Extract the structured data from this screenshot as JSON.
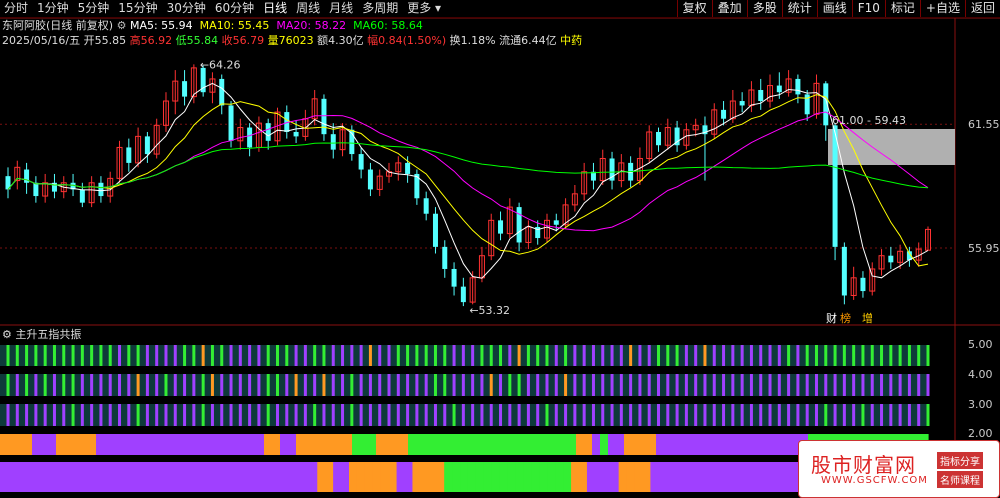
{
  "toolbar": {
    "periods": [
      "分时",
      "1分钟",
      "5分钟",
      "15分钟",
      "30分钟",
      "60分钟",
      "日线",
      "周线",
      "月线",
      "多周期",
      "更多"
    ],
    "active_period": "日线",
    "tools": [
      "复权",
      "叠加",
      "多股",
      "统计",
      "画线",
      "F10",
      "标记",
      "+自选",
      "返回"
    ]
  },
  "info": {
    "stock": "东阿阿胶(日线 前复权)",
    "ma5": "MA5: 55.94",
    "ma10": "MA10: 55.45",
    "ma20": "MA20: 58.22",
    "ma60": "MA60: 58.64",
    "date": "2025/05/16/五",
    "open": "开55.85",
    "high": "高56.92",
    "low": "低55.84",
    "close": "收56.79",
    "volume": "量76023",
    "amount": "额4.30亿",
    "change": "幅0.84(1.50%)",
    "turnover": "换1.18%",
    "float": "流通6.44亿",
    "sector": "中药"
  },
  "colors": {
    "up": "#ff3232",
    "down": "#54ffff",
    "ma5": "#ffffff",
    "ma10": "#ffff00",
    "ma20": "#ff00ff",
    "ma60": "#00ff00"
  },
  "chart_data": {
    "type": "candlestick",
    "price_axis_labels": [
      "61.55",
      "55.95"
    ],
    "annotations": {
      "high": "64.26",
      "low": "53.32",
      "range": "61.00 - 59.43",
      "events": [
        "财",
        "榜",
        "增"
      ]
    },
    "candles": [
      [
        59.2,
        58.6,
        58.2,
        59.6
      ],
      [
        59.0,
        59.6,
        58.6,
        59.9
      ],
      [
        59.5,
        58.9,
        58.4,
        59.8
      ],
      [
        58.9,
        58.3,
        58.0,
        59.2
      ],
      [
        58.3,
        58.9,
        58.0,
        59.3
      ],
      [
        58.9,
        58.5,
        58.2,
        59.3
      ],
      [
        58.5,
        58.9,
        58.2,
        59.2
      ],
      [
        58.9,
        58.6,
        58.3,
        59.3
      ],
      [
        58.6,
        58.0,
        57.8,
        58.9
      ],
      [
        58.0,
        58.9,
        57.8,
        59.2
      ],
      [
        58.9,
        58.3,
        58.0,
        59.2
      ],
      [
        58.3,
        59.1,
        58.0,
        59.4
      ],
      [
        59.1,
        60.5,
        58.9,
        60.8
      ],
      [
        60.5,
        59.8,
        59.4,
        60.9
      ],
      [
        59.8,
        61.0,
        59.6,
        61.4
      ],
      [
        61.0,
        60.2,
        59.8,
        61.2
      ],
      [
        60.2,
        61.5,
        60.0,
        61.8
      ],
      [
        61.5,
        62.6,
        61.2,
        63.0
      ],
      [
        62.6,
        63.5,
        62.0,
        64.0
      ],
      [
        63.5,
        62.8,
        62.4,
        64.0
      ],
      [
        62.8,
        64.1,
        62.5,
        64.26
      ],
      [
        64.1,
        63.0,
        62.8,
        64.2
      ],
      [
        63.0,
        63.6,
        62.5,
        63.9
      ],
      [
        63.6,
        62.4,
        62.0,
        63.8
      ],
      [
        62.4,
        60.8,
        60.5,
        62.6
      ],
      [
        60.8,
        61.4,
        60.4,
        61.8
      ],
      [
        61.4,
        60.5,
        60.1,
        61.6
      ],
      [
        60.5,
        61.6,
        60.3,
        61.9
      ],
      [
        61.6,
        60.8,
        60.4,
        61.8
      ],
      [
        60.8,
        62.1,
        60.6,
        62.3
      ],
      [
        62.1,
        61.2,
        60.9,
        62.4
      ],
      [
        61.2,
        61.0,
        60.7,
        61.7
      ],
      [
        61.0,
        61.8,
        60.8,
        62.2
      ],
      [
        61.8,
        62.7,
        61.5,
        63.1
      ],
      [
        62.7,
        61.1,
        60.8,
        62.9
      ],
      [
        61.1,
        60.4,
        60.0,
        61.6
      ],
      [
        60.4,
        61.3,
        60.1,
        61.6
      ],
      [
        61.3,
        60.2,
        59.9,
        61.5
      ],
      [
        60.2,
        59.5,
        59.1,
        60.5
      ],
      [
        59.5,
        58.6,
        58.3,
        59.8
      ],
      [
        58.6,
        59.2,
        58.3,
        59.5
      ],
      [
        59.2,
        59.4,
        58.9,
        59.8
      ],
      [
        59.4,
        59.8,
        59.0,
        60.1
      ],
      [
        59.8,
        59.3,
        58.9,
        60.1
      ],
      [
        59.3,
        58.2,
        57.9,
        59.5
      ],
      [
        58.2,
        57.5,
        57.2,
        58.5
      ],
      [
        57.5,
        56.0,
        55.7,
        57.8
      ],
      [
        56.0,
        55.0,
        54.6,
        56.3
      ],
      [
        55.0,
        54.2,
        53.8,
        55.3
      ],
      [
        54.2,
        53.5,
        53.32,
        54.6
      ],
      [
        53.5,
        54.6,
        53.4,
        54.9
      ],
      [
        54.6,
        55.6,
        54.4,
        56.0
      ],
      [
        55.6,
        57.2,
        55.4,
        57.5
      ],
      [
        57.2,
        56.6,
        56.3,
        57.6
      ],
      [
        56.6,
        57.8,
        56.4,
        58.2
      ],
      [
        57.8,
        56.2,
        55.8,
        58.0
      ],
      [
        56.2,
        56.9,
        55.9,
        57.2
      ],
      [
        56.9,
        56.4,
        56.1,
        57.2
      ],
      [
        56.4,
        57.2,
        56.2,
        57.5
      ],
      [
        57.2,
        57.0,
        56.7,
        57.5
      ],
      [
        57.0,
        57.9,
        56.8,
        58.2
      ],
      [
        57.9,
        58.4,
        57.6,
        58.8
      ],
      [
        58.4,
        59.4,
        58.1,
        59.8
      ],
      [
        59.4,
        59.0,
        58.6,
        59.8
      ],
      [
        59.0,
        60.0,
        58.8,
        60.4
      ],
      [
        60.0,
        59.0,
        58.6,
        60.3
      ],
      [
        59.0,
        59.8,
        58.7,
        60.2
      ],
      [
        59.8,
        59.0,
        58.7,
        60.1
      ],
      [
        59.0,
        60.0,
        58.8,
        60.5
      ],
      [
        60.0,
        61.2,
        59.8,
        61.5
      ],
      [
        61.2,
        60.6,
        60.3,
        61.4
      ],
      [
        60.6,
        61.4,
        60.4,
        61.8
      ],
      [
        61.4,
        60.6,
        60.3,
        61.7
      ],
      [
        60.6,
        61.3,
        60.4,
        61.6
      ],
      [
        61.3,
        61.5,
        61.0,
        61.8
      ],
      [
        61.5,
        61.1,
        59.0,
        61.9
      ],
      [
        61.1,
        62.2,
        60.9,
        62.5
      ],
      [
        62.2,
        61.8,
        61.5,
        62.6
      ],
      [
        61.8,
        62.6,
        61.6,
        63.1
      ],
      [
        62.6,
        62.4,
        62.1,
        63.0
      ],
      [
        62.4,
        63.1,
        62.1,
        63.5
      ],
      [
        63.1,
        62.6,
        62.2,
        63.6
      ],
      [
        62.6,
        63.3,
        62.3,
        63.8
      ],
      [
        63.3,
        63.0,
        62.7,
        63.9
      ],
      [
        63.0,
        63.6,
        62.8,
        64.0
      ],
      [
        63.6,
        62.9,
        62.5,
        63.8
      ],
      [
        62.9,
        62.0,
        61.7,
        63.1
      ],
      [
        62.0,
        63.4,
        61.8,
        63.8
      ],
      [
        63.4,
        61.5,
        60.8,
        63.5
      ],
      [
        61.5,
        56.0,
        55.4,
        61.6
      ],
      [
        56.0,
        53.8,
        53.4,
        56.2
      ],
      [
        53.8,
        54.6,
        53.6,
        55.1
      ],
      [
        54.6,
        54.0,
        53.7,
        54.9
      ],
      [
        54.0,
        55.0,
        53.8,
        55.3
      ],
      [
        55.0,
        55.6,
        54.7,
        55.9
      ],
      [
        55.6,
        55.3,
        55.0,
        56.0
      ],
      [
        55.3,
        55.8,
        55.0,
        56.1
      ],
      [
        55.8,
        55.4,
        55.1,
        56.0
      ],
      [
        55.4,
        55.9,
        55.1,
        56.2
      ],
      [
        55.85,
        56.79,
        55.84,
        56.92
      ]
    ],
    "indicator": {
      "title": "主升五指共振",
      "axis_labels": [
        "5.00",
        "4.00",
        "3.00",
        "2.00"
      ],
      "row1": "GGGGGGGGGGGGPGGPPPPGGOGGPPPPGGGPPGGPPPPOPPGGGGGGPPPGGGPOGGGPGPPPPPPOPPGGGPPOPPPPPPPPGPGGGGGGGGGGGGGGG",
      "row2": "GPGPGPGGPPPPPPOPPGPPPGOPPPPPGGPOPPOPPGPPPPPPPPGGPPPPOPGGPPPPOPPPPPPPPPPPPPPPPPPPPPPPPPPPPPPPPPPPPPPPPO",
      "row3": "PPPPPPPGPPPPPPGPPPPPPGPPPPPPGPPPPGPPPGPPPPPPPPPPGPPPPPPPPPGPPPPPPPPPPPPPPPPPPPPPPPPPPPPPGPPPGPPPPPPGGG",
      "row4": "OOOOPPPOOOOOPPPPPPPPPPPPPPPPPPPPPOOPPOOOOOOOGGGOOOOGGGGGGGGGGGGGGGGGGGGGOOPGPPOOOOPPPPPPPPPPPPPPPPPPPGGGGGGGGGGGGGGG",
      "row5": "PPPPPPPPPPPPPPPPPPPPPPPPPPPPPPPPPPPPPPPPOOPPOOOOOOPPOOOOGGGGGGGGGGGGGGGGOOPPPPOOOOPPPPPPPPPPPPPPPPPPPPPPPPPPPPPPPPPPP"
    }
  },
  "watermark": {
    "title": "股市财富网",
    "url": "WWW.GSCFW.COM",
    "tag1": "指标分享",
    "tag2": "名师课程"
  }
}
